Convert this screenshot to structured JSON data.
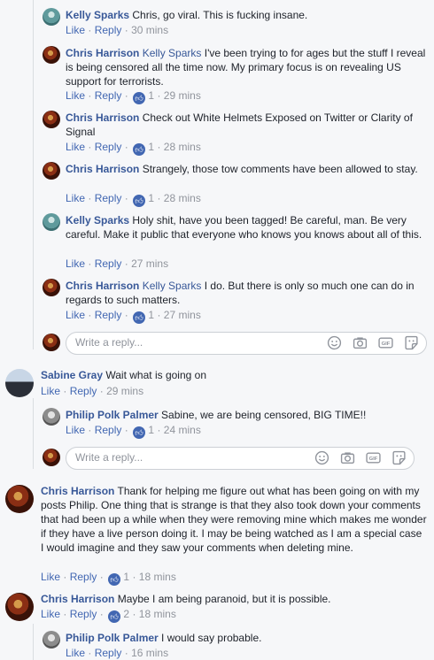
{
  "labels": {
    "like": "Like",
    "reply": "Reply",
    "dot": "·"
  },
  "reply_box": {
    "placeholder": "Write a reply..."
  },
  "comments": [
    {
      "author": "Kelly Sparks",
      "tag": "",
      "text": "Chris, go viral. This is fucking insane.",
      "reactions": "",
      "time": "30 mins"
    },
    {
      "author": "Chris Harrison",
      "tag": "Kelly Sparks",
      "text": "I've been trying to for ages but the stuff I reveal is being censored all the time now. My primary focus is on revealing US support for terrorists.",
      "reactions": "1",
      "time": "29 mins"
    },
    {
      "author": "Chris Harrison",
      "tag": "",
      "text": "Check out White Helmets Exposed on Twitter or Clarity of Signal",
      "reactions": "1",
      "time": "28 mins"
    },
    {
      "author": "Chris Harrison",
      "tag": "",
      "text": "Strangely, those tow comments have been allowed to stay.",
      "reactions": "1",
      "time": "28 mins"
    },
    {
      "author": "Kelly Sparks",
      "tag": "",
      "text": "Holy shit, have you been tagged! Be careful, man. Be very careful. Make it public that everyone who knows you knows about all of this.",
      "reactions": "",
      "time": "27 mins"
    },
    {
      "author": "Chris Harrison",
      "tag": "Kelly Sparks",
      "text": "I do. But there is only so much one can do in regards to such matters.",
      "reactions": "1",
      "time": "27 mins"
    },
    {
      "author": "Sabine Gray",
      "tag": "",
      "text": "Wait what is going on",
      "reactions": "",
      "time": "29 mins"
    },
    {
      "author": "Philip Polk Palmer",
      "tag": "",
      "text": "Sabine, we are being censored, BIG TIME!!",
      "reactions": "1",
      "time": "24 mins"
    },
    {
      "author": "Chris Harrison",
      "tag": "",
      "text": "Thank for helping me figure out what has been going on with my posts Philip. One thing that is strange is that they also took down your comments that had been up a while when they were removing mine which makes me wonder if they have a live person doing it. I may be being watched as I am a special case I would imagine and they saw your comments when deleting mine.",
      "reactions": "1",
      "time": "18 mins"
    },
    {
      "author": "Chris Harrison",
      "tag": "",
      "text": "Maybe I am being paranoid, but it is possible.",
      "reactions": "2",
      "time": "18 mins"
    },
    {
      "author": "Philip Polk Palmer",
      "tag": "",
      "text": "I would say probable.",
      "reactions": "",
      "time": "16 mins"
    }
  ],
  "icons": [
    "emoji-icon",
    "camera-icon",
    "gif-icon",
    "sticker-icon",
    "like-thumb-icon"
  ],
  "colors": {
    "link": "#385898",
    "action": "#4267b2",
    "muted": "#90949c",
    "background": "#f6f7f9"
  }
}
